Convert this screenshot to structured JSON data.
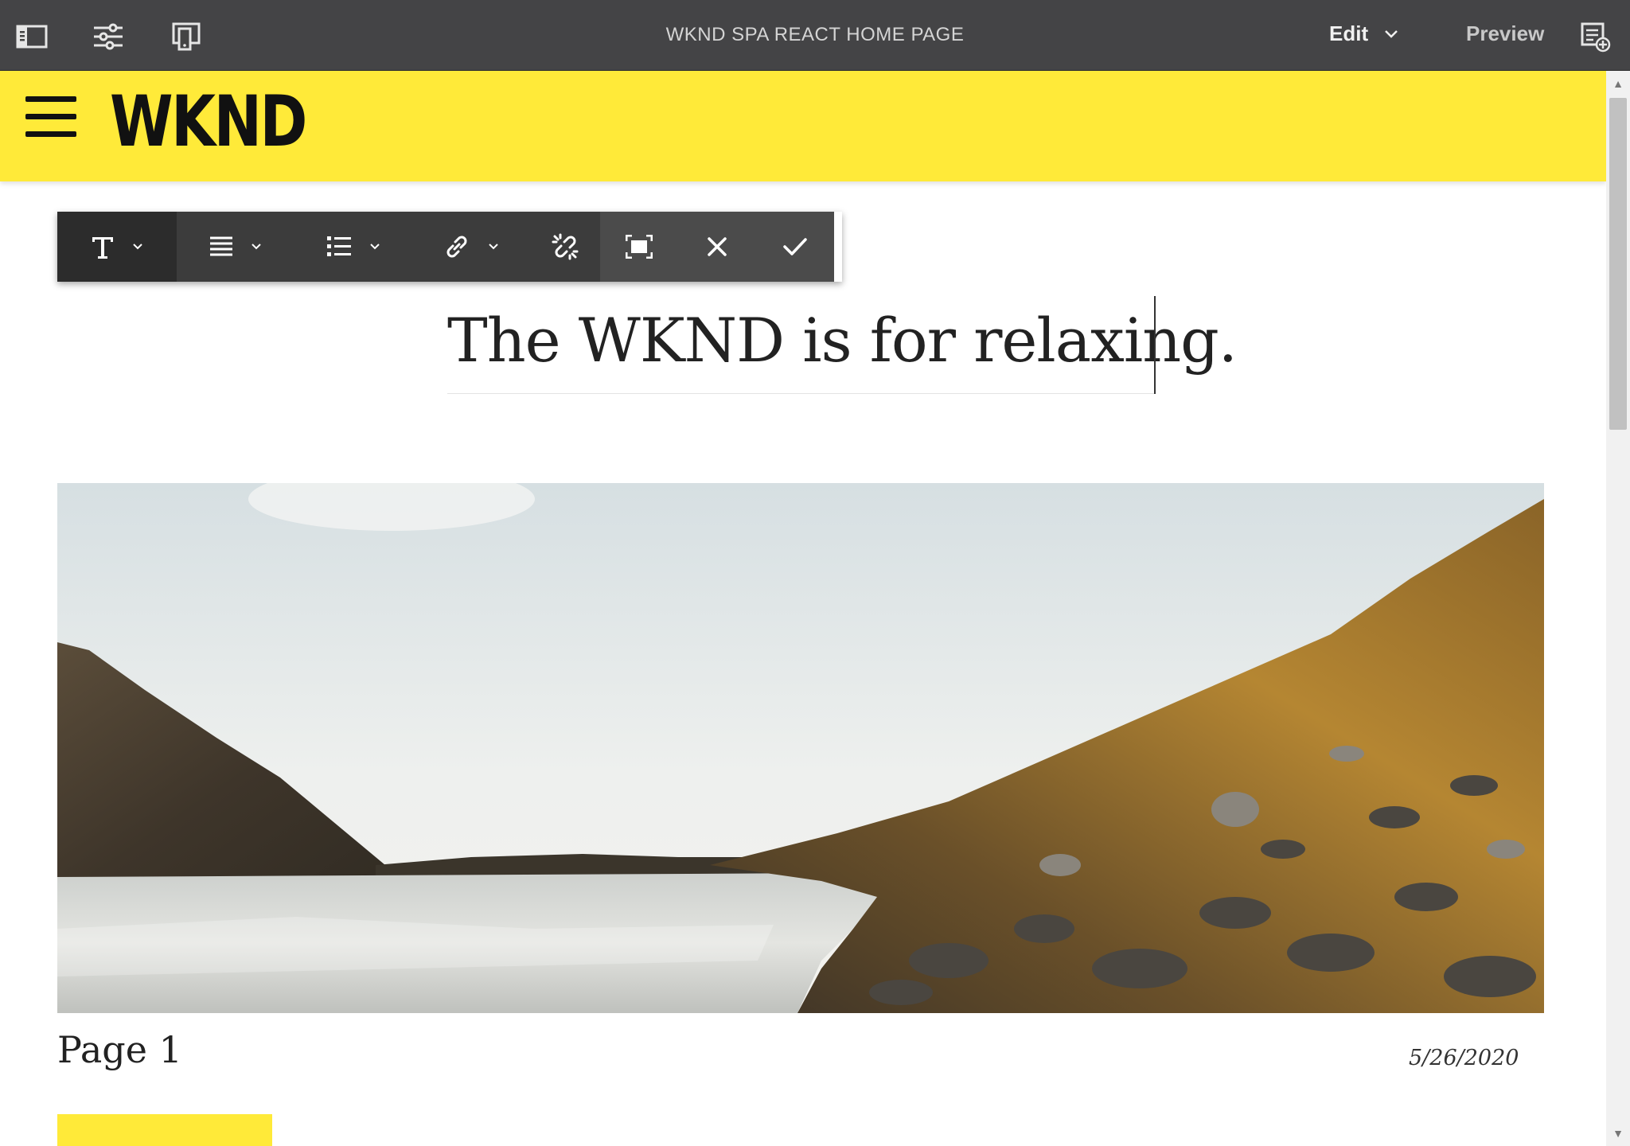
{
  "editor": {
    "page_title": "WKND SPA REACT HOME PAGE",
    "mode_label": "Edit",
    "preview_label": "Preview",
    "icons": [
      "side-panel-icon",
      "page-properties-icon",
      "emulator-icon",
      "annotations-icon"
    ]
  },
  "site": {
    "logo": "WKND",
    "colors": {
      "brand_yellow": "#ffea39",
      "toolbar_dark": "#2c2c2c"
    }
  },
  "rte_toolbar": {
    "buttons": [
      "format-icon",
      "justify-icon",
      "list-icon",
      "link-icon",
      "unlink-icon",
      "fullscreen-icon",
      "cancel-icon",
      "save-icon"
    ]
  },
  "content": {
    "title": "The WKND is for relaxing.",
    "card": {
      "title": "Page 1",
      "date": "5/26/2020"
    }
  }
}
